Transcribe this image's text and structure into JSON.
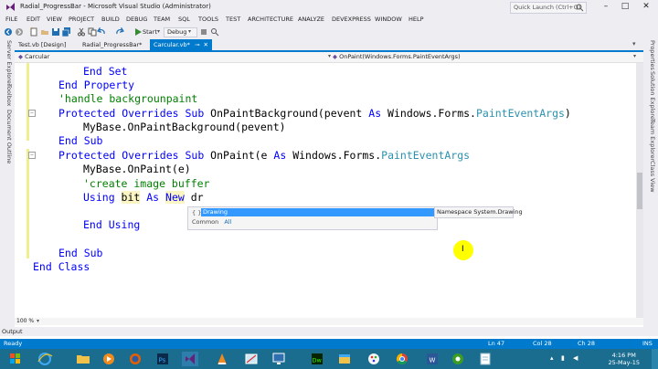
{
  "window": {
    "title": "Radial_ProgressBar - Microsoft Visual Studio (Administrator)",
    "quick_launch_placeholder": "Quick Launch (Ctrl+Q)",
    "min": "–",
    "max": "□",
    "close": "✕"
  },
  "menu": [
    "FILE",
    "EDIT",
    "VIEW",
    "PROJECT",
    "BUILD",
    "DEBUG",
    "TEAM",
    "SQL",
    "TOOLS",
    "TEST",
    "ARCHITECTURE",
    "ANALYZE",
    "DEVEXPRESS",
    "WINDOW",
    "HELP"
  ],
  "toolbar": {
    "start_label": "Start",
    "config": "Debug"
  },
  "left_tabs": [
    "Server Explorer",
    "Toolbox",
    "Document Outline"
  ],
  "right_tabs": [
    "Properties",
    "Solution Explorer",
    "Team Explorer",
    "Class View"
  ],
  "doc_tabs": [
    "Test.vb [Design]",
    "Radial_ProgressBar*",
    "Carcular.vb*"
  ],
  "nav": {
    "left": "Carcular",
    "right": "OnPaint(Windows.Forms.PaintEventArgs)"
  },
  "code": {
    "l1": "End Set",
    "l2a": "End ",
    "l2b": "Property",
    "l3": "'handle backgrounpaint",
    "l4a": "Protected Overrides Sub ",
    "l4b": "OnPaintBackground(pevent ",
    "l4c": "As ",
    "l4d": "Windows.Forms.",
    "l4e": "PaintEventArgs",
    "l4f": ")",
    "l5": "MyBase.OnPaintBackground(pevent)",
    "l6": "End Sub",
    "l7a": "Protected Overrides Sub ",
    "l7b": "OnPaint(e ",
    "l7c": "As ",
    "l7d": "Windows.Forms.",
    "l7e": "PaintEventArgs",
    "l8": "MyBase.OnPaint(e)",
    "l9": "'create image buffer",
    "l10a": "Using ",
    "l10b": "bit",
    "l10c": " As ",
    "l10d": "New",
    "l10e": " dr",
    "l11": "End Using",
    "l12": "End Sub",
    "l13": "End Class"
  },
  "intellisense": {
    "item": "Drawing",
    "icon": "{ }",
    "tooltip": "Namespace System.Drawing",
    "tab_common": "Common",
    "tab_all": "All"
  },
  "zoom": "100 %",
  "output_tab": "Output",
  "status": {
    "ready": "Ready",
    "ln": "Ln 47",
    "col": "Col 28",
    "ch": "Ch 28",
    "mode": "INS"
  },
  "clock": {
    "time": "4:16 PM",
    "date": "25-May-15"
  },
  "colors": {
    "accent": "#007acc",
    "taskbar": "#1b6d90",
    "keyword": "#0000ff",
    "comment": "#008000",
    "type": "#2b91af"
  }
}
